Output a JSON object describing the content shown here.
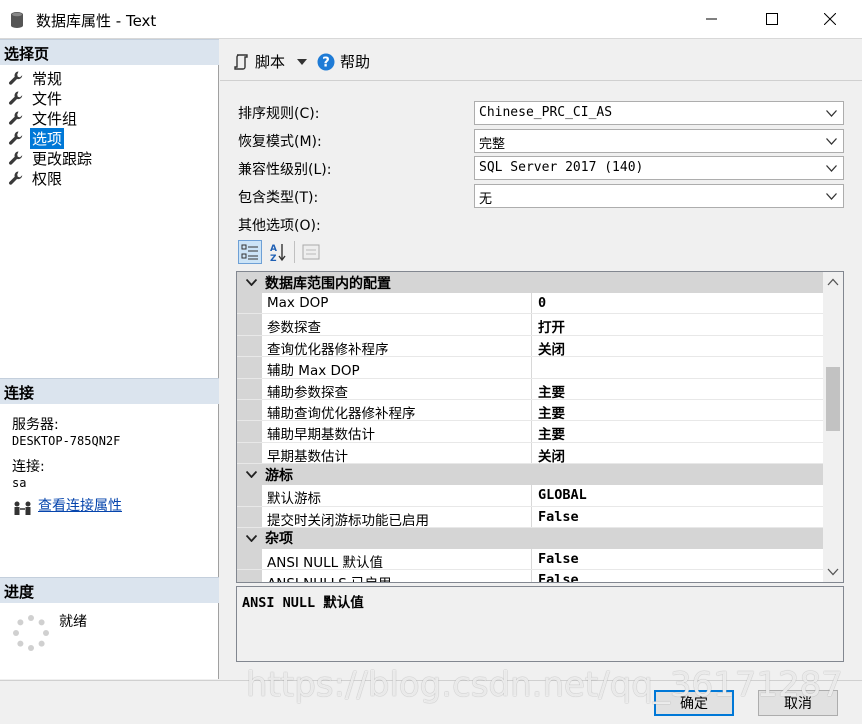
{
  "window": {
    "title": "数据库属性 - Text",
    "minimize_icon": "minimize-icon",
    "maximize_icon": "maximize-icon",
    "close_icon": "close-icon"
  },
  "sidebar": {
    "section_title": "选择页",
    "items": [
      {
        "label": "常规",
        "selected": false
      },
      {
        "label": "文件",
        "selected": false
      },
      {
        "label": "文件组",
        "selected": false
      },
      {
        "label": "选项",
        "selected": true
      },
      {
        "label": "更改跟踪",
        "selected": false
      },
      {
        "label": "权限",
        "selected": false
      }
    ],
    "connection": {
      "section_title": "连接",
      "server_label": "服务器:",
      "server_value": "DESKTOP-785QN2F",
      "conn_label": "连接:",
      "conn_value": "sa",
      "view_link": "查看连接属性"
    },
    "progress": {
      "section_title": "进度",
      "status": "就绪"
    }
  },
  "toolbar": {
    "script_label": "脚本",
    "help_label": "帮助"
  },
  "form": {
    "collation_label": "排序规则(C):",
    "collation_value": "Chinese_PRC_CI_AS",
    "recovery_label": "恢复模式(M):",
    "recovery_value": "完整",
    "compat_label": "兼容性级别(L):",
    "compat_value": "SQL Server 2017 (140)",
    "containment_label": "包含类型(T):",
    "containment_value": "无",
    "other_label": "其他选项(O):"
  },
  "grid": {
    "categories": [
      {
        "name": "数据库范围内的配置",
        "rows": [
          {
            "name": "Max DOP",
            "value": "0"
          },
          {
            "name": "参数探查",
            "value": "打开"
          },
          {
            "name": "查询优化器修补程序",
            "value": "关闭"
          },
          {
            "name": "辅助 Max DOP",
            "value": ""
          },
          {
            "name": "辅助参数探查",
            "value": "主要"
          },
          {
            "name": "辅助查询优化器修补程序",
            "value": "主要"
          },
          {
            "name": "辅助早期基数估计",
            "value": "主要"
          },
          {
            "name": "早期基数估计",
            "value": "关闭"
          }
        ]
      },
      {
        "name": "游标",
        "rows": [
          {
            "name": "默认游标",
            "value": "GLOBAL"
          },
          {
            "name": "提交时关闭游标功能已启用",
            "value": "False"
          }
        ]
      },
      {
        "name": "杂项",
        "rows": [
          {
            "name": "ANSI NULL 默认值",
            "value": "False"
          },
          {
            "name": "ANSI NULLS 已启用",
            "value": "False"
          }
        ]
      }
    ],
    "description": "ANSI NULL 默认值"
  },
  "buttons": {
    "ok": "确定",
    "cancel": "取消"
  },
  "watermark": "https://blog.csdn.net/qq_36171287",
  "colors": {
    "selection": "#0078d7",
    "section_header": "#dbe4ee",
    "category_row": "#d5d5d5"
  }
}
